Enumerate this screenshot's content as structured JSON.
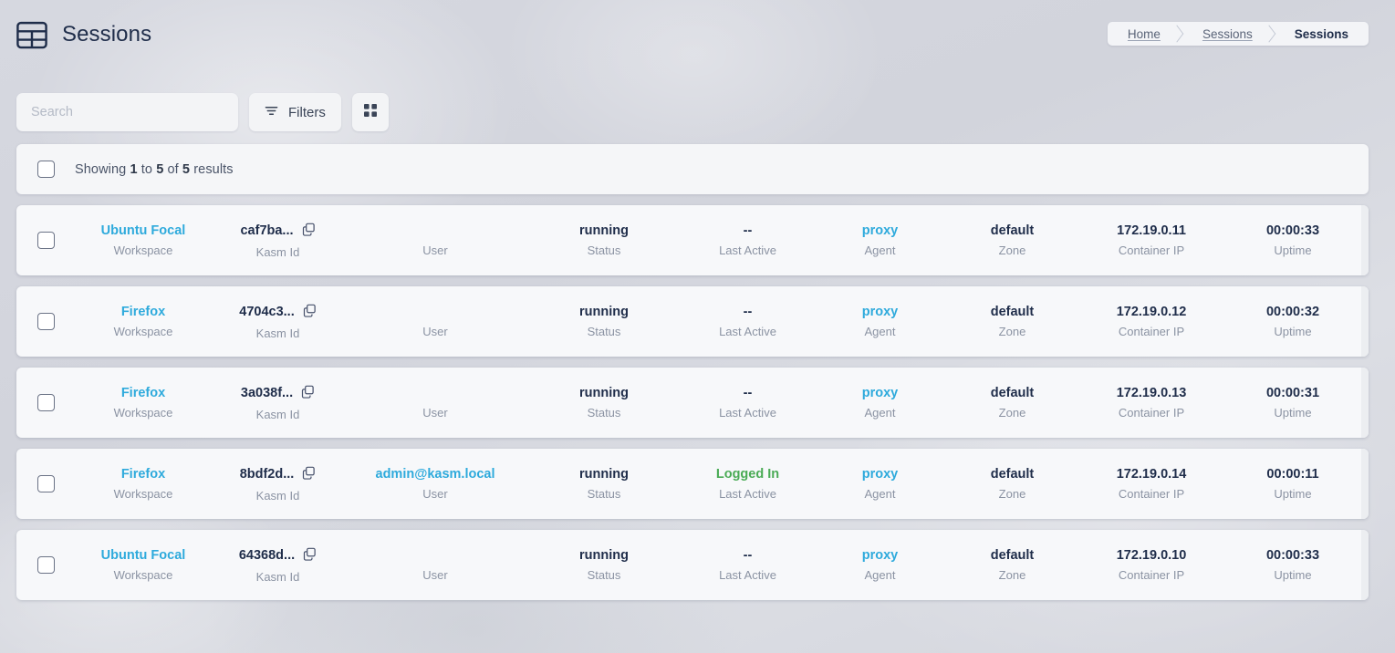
{
  "header": {
    "title": "Sessions",
    "icon": "table-icon",
    "breadcrumb": [
      {
        "label": "Home",
        "active": false
      },
      {
        "label": "Sessions",
        "active": false
      },
      {
        "label": "Sessions",
        "active": true
      }
    ]
  },
  "toolbar": {
    "search_placeholder": "Search",
    "search_value": "",
    "filters_label": "Filters",
    "filters_icon": "filter-icon",
    "grid_view_icon": "grid-view-icon"
  },
  "results": {
    "prefix": "Showing ",
    "from": "1",
    "mid1": " to ",
    "to": "5",
    "mid2": " of ",
    "total": "5",
    "suffix": " results"
  },
  "columns": {
    "workspace": "Workspace",
    "kasm_id": "Kasm Id",
    "user": "User",
    "status": "Status",
    "last_active": "Last Active",
    "agent": "Agent",
    "zone": "Zone",
    "container_ip": "Container IP",
    "uptime": "Uptime"
  },
  "colors": {
    "link": "#2eaadc",
    "logged_in": "#4aab55",
    "value": "#1f2d4a",
    "label": "#8b93a3",
    "page_bg": "#d4d6de",
    "card_bg": "#f7f8fa"
  },
  "rows": [
    {
      "workspace": "Ubuntu Focal",
      "kasm_id": "caf7ba...",
      "user": "",
      "status": "running",
      "last_active": "--",
      "last_active_state": "none",
      "agent": "proxy",
      "zone": "default",
      "container_ip": "172.19.0.11",
      "uptime": "00:00:33"
    },
    {
      "workspace": "Firefox",
      "kasm_id": "4704c3...",
      "user": "",
      "status": "running",
      "last_active": "--",
      "last_active_state": "none",
      "agent": "proxy",
      "zone": "default",
      "container_ip": "172.19.0.12",
      "uptime": "00:00:32"
    },
    {
      "workspace": "Firefox",
      "kasm_id": "3a038f...",
      "user": "",
      "status": "running",
      "last_active": "--",
      "last_active_state": "none",
      "agent": "proxy",
      "zone": "default",
      "container_ip": "172.19.0.13",
      "uptime": "00:00:31"
    },
    {
      "workspace": "Firefox",
      "kasm_id": "8bdf2d...",
      "user": "admin@kasm.local",
      "status": "running",
      "last_active": "Logged In",
      "last_active_state": "logged-in",
      "agent": "proxy",
      "zone": "default",
      "container_ip": "172.19.0.14",
      "uptime": "00:00:11"
    },
    {
      "workspace": "Ubuntu Focal",
      "kasm_id": "64368d...",
      "user": "",
      "status": "running",
      "last_active": "--",
      "last_active_state": "none",
      "agent": "proxy",
      "zone": "default",
      "container_ip": "172.19.0.10",
      "uptime": "00:00:33"
    }
  ]
}
